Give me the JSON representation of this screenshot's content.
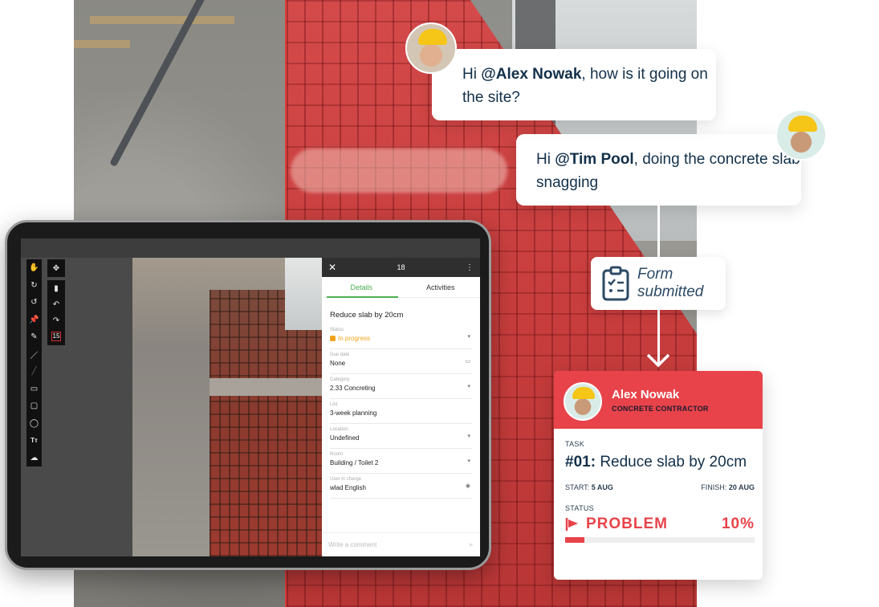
{
  "chat": {
    "message1": {
      "prefix": "Hi ",
      "mention": "@Alex Nowak",
      "suffix": ", how is it going on the site?"
    },
    "message2": {
      "prefix": "Hi ",
      "mention": "@Tim Pool",
      "suffix": ", doing the concrete slab snagging"
    }
  },
  "form_chip": {
    "line1": "Form",
    "line2": "submitted"
  },
  "task_card": {
    "name": "Alex Nowak",
    "role": "CONCRETE CONTRACTOR",
    "task_label": "TASK",
    "task_number": "#01:",
    "task_title": "Reduce slab by 20cm",
    "start_label": "START:",
    "start_value": "5 AUG",
    "finish_label": "FINISH:",
    "finish_value": "20 AUG",
    "status_label": "STATUS",
    "status_value": "PROBLEM",
    "progress_text": "10%",
    "progress_value": 0.1,
    "accent_color": "#e8434a"
  },
  "tablet": {
    "panel": {
      "count": "18",
      "tabs": [
        {
          "label": "Details",
          "active": true
        },
        {
          "label": "Activities",
          "active": false
        }
      ],
      "title": "Reduce slab by 20cm",
      "fields": [
        {
          "label": "Status",
          "value": "In progress",
          "icon": "chevron-down"
        },
        {
          "label": "Due date",
          "value": "None",
          "icon": "calendar"
        },
        {
          "label": "Category",
          "value": "2.33 Concreting",
          "icon": "chevron-down"
        },
        {
          "label": "List",
          "value": "3-week planning",
          "icon": ""
        },
        {
          "label": "Location",
          "value": "Undefined",
          "icon": "chevron-down"
        },
        {
          "label": "Room",
          "value": "Building / Toilet 2",
          "icon": "chevron-down"
        },
        {
          "label": "User in charge",
          "value": "wlad English",
          "icon": "eye"
        }
      ],
      "comment_placeholder": "Write a comment"
    },
    "toolbar": {
      "left_tools": [
        "hand",
        "rotate-cw",
        "rotate-ccw",
        "pin",
        "pencil",
        "pen",
        "line",
        "rectangle",
        "rounded-rect",
        "ellipse",
        "text",
        "cloud"
      ],
      "right_tools": [
        "move",
        "trash",
        "undo",
        "redo"
      ],
      "page_badge": "15"
    }
  }
}
